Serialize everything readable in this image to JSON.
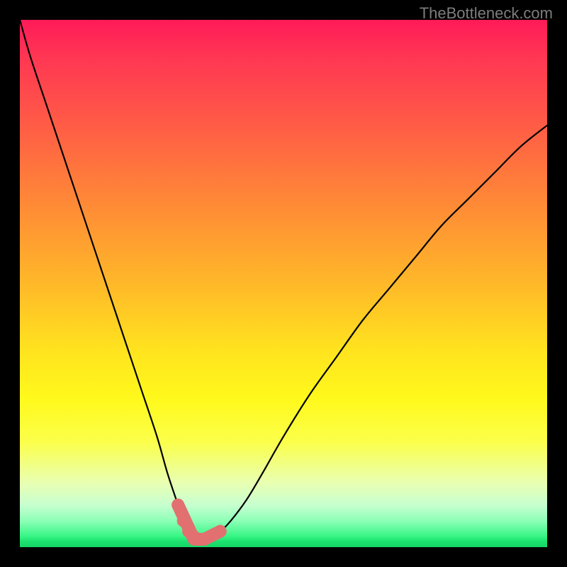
{
  "watermark": "TheBottleneck.com",
  "chart_data": {
    "type": "line",
    "title": "",
    "xlabel": "",
    "ylabel": "",
    "xlim": [
      0,
      100
    ],
    "ylim": [
      0,
      100
    ],
    "x": [
      0,
      2,
      5,
      8,
      11,
      14,
      17,
      20,
      23,
      26,
      28,
      30,
      31,
      32,
      33,
      34,
      35,
      36,
      38,
      40,
      43,
      46,
      50,
      55,
      60,
      65,
      70,
      75,
      80,
      85,
      90,
      95,
      100
    ],
    "y": [
      100,
      93,
      84,
      75,
      66,
      57,
      48,
      39,
      30,
      21,
      14,
      8,
      5,
      3,
      2,
      1.5,
      1.5,
      2,
      3,
      5,
      9,
      14,
      21,
      29,
      36,
      43,
      49,
      55,
      61,
      66,
      71,
      76,
      80
    ],
    "min_region": {
      "x_start": 30,
      "x_end": 38,
      "y_start": 8,
      "y_end": 3
    },
    "colors": {
      "curve": "#000000",
      "marker": "#e27070",
      "gradient_top": "#ff1a58",
      "gradient_bottom": "#16d767"
    },
    "grid": false,
    "legend": null
  }
}
